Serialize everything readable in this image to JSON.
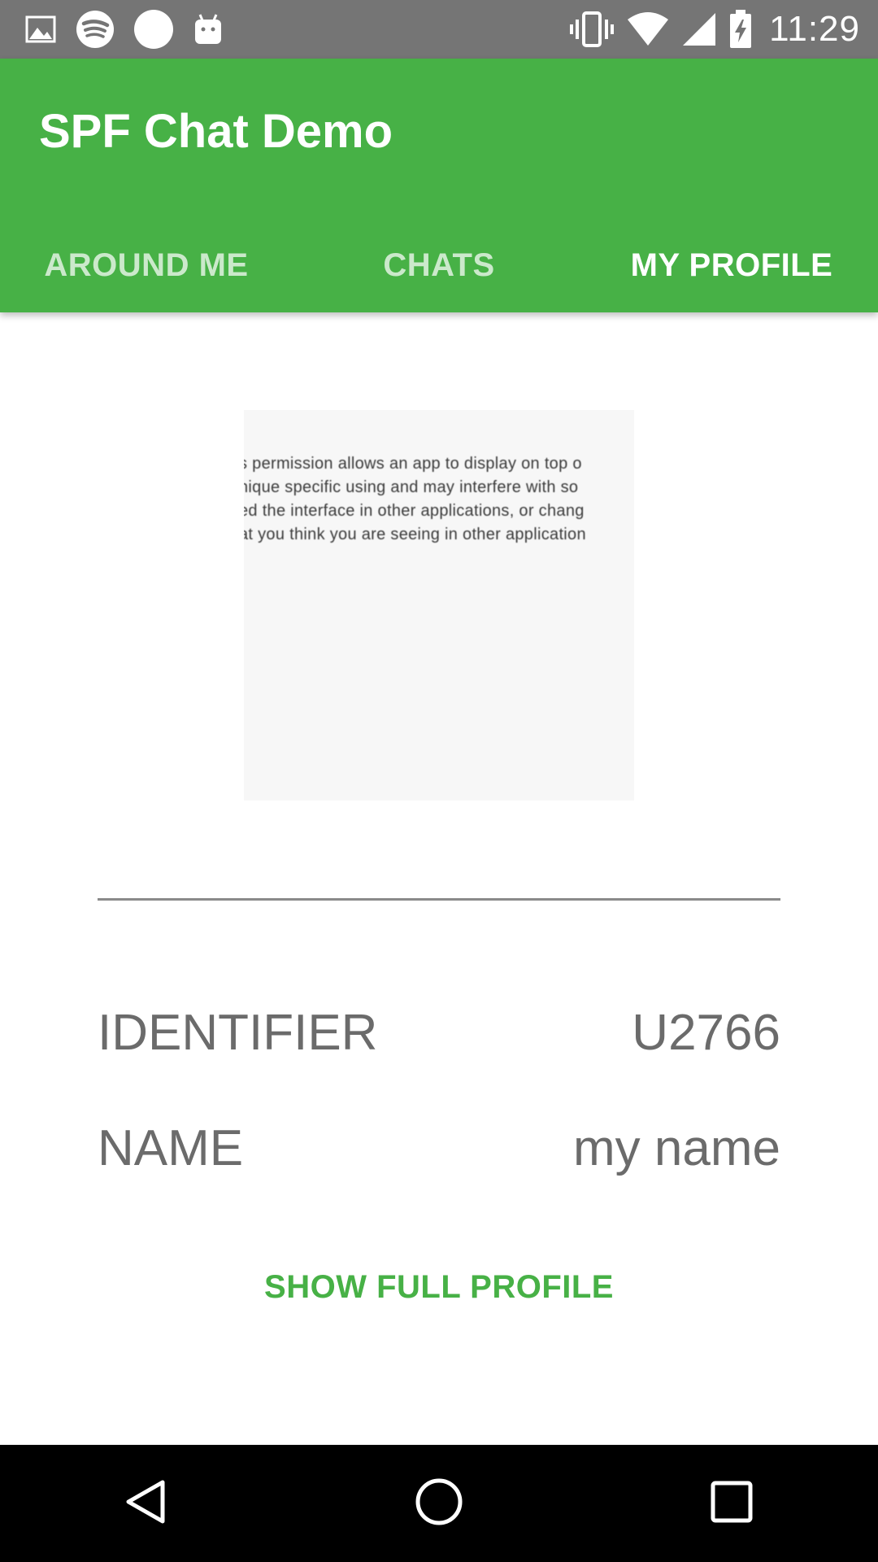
{
  "status_bar": {
    "time": "11:29",
    "icons_left": [
      "image-icon",
      "spotify-icon",
      "circle-icon",
      "android-icon"
    ],
    "icons_right": [
      "vibrate-icon",
      "wifi-icon",
      "signal-icon",
      "battery-charging-icon"
    ]
  },
  "app_bar": {
    "title": "SPF Chat Demo",
    "color": "#47b146",
    "tabs": [
      {
        "label": "AROUND ME",
        "active": false
      },
      {
        "label": "CHATS",
        "active": false
      },
      {
        "label": "MY PROFILE",
        "active": true
      }
    ]
  },
  "profile": {
    "image_text": [
      "s permission allows an app to display on top o",
      "nique specific using and may interfere with so",
      "ed the interface in other applications, or chang",
      "at you think you are seeing in other application"
    ],
    "fields": [
      {
        "label": "IDENTIFIER",
        "value": "U2766"
      },
      {
        "label": "NAME",
        "value": "my name"
      }
    ],
    "show_full_label": "SHOW FULL PROFILE"
  },
  "nav_bar": {
    "buttons": [
      "back-icon",
      "home-icon",
      "recents-icon"
    ]
  }
}
